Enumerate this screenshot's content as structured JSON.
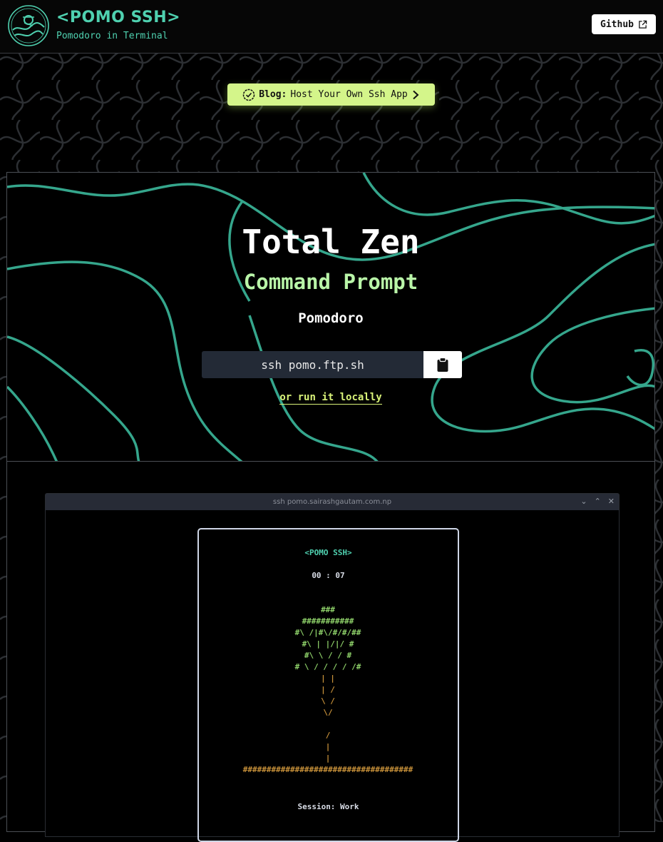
{
  "header": {
    "brand_name": "<POMO SSH>",
    "tagline": "Pomodoro in Terminal",
    "github_label": "Github"
  },
  "blog_pill": {
    "prefix": "Blog:",
    "text": "Host Your Own Ssh App"
  },
  "hero": {
    "title": "Total Zen",
    "subtitle": "Command Prompt",
    "small": "Pomodoro",
    "command": "ssh pomo.ftp.sh",
    "local_link": "or run it locally"
  },
  "terminal": {
    "window_title": "ssh pomo.sairashgautam.com.np",
    "app_title": "<POMO SSH>",
    "timer": "00 : 07",
    "session": "Session: Work",
    "tree_lines": [
      "###",
      "###########",
      "#\\ /|#\\/#/#/##",
      "#\\ | |/|/    #",
      "#\\ \\       / / #",
      "#   \\ / / / / /#",
      "|  |",
      "|  /",
      "\\ /",
      "\\/",
      "",
      "/",
      "|",
      "|",
      "####################################"
    ]
  },
  "colors": {
    "brand_teal": "#4fd1b0",
    "pill_lime": "#d4f58a",
    "subtitle_green": "#b9f5a8",
    "tree_green": "#8fd26a",
    "tree_trunk": "#c9923a"
  },
  "icons": [
    "logo-icon",
    "external-link-icon",
    "check-circle-icon",
    "chevron-right-icon",
    "clipboard-icon"
  ]
}
